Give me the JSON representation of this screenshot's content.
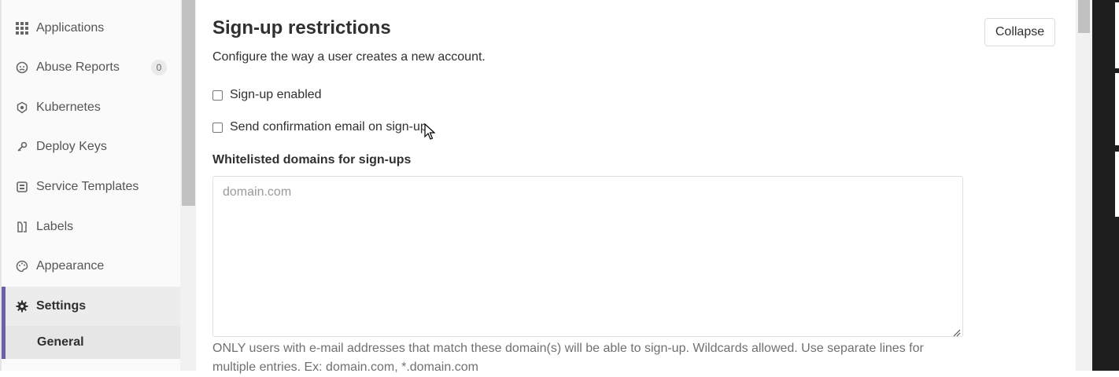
{
  "sidebar": {
    "items": [
      {
        "label": "Applications",
        "icon": "applications-icon"
      },
      {
        "label": "Abuse Reports",
        "icon": "abuse-reports-icon",
        "badge": "0"
      },
      {
        "label": "Kubernetes",
        "icon": "kubernetes-icon"
      },
      {
        "label": "Deploy Keys",
        "icon": "deploy-keys-icon"
      },
      {
        "label": "Service Templates",
        "icon": "service-templates-icon"
      },
      {
        "label": "Labels",
        "icon": "labels-icon"
      },
      {
        "label": "Appearance",
        "icon": "appearance-icon"
      },
      {
        "label": "Settings",
        "icon": "gear-icon",
        "active": true
      }
    ],
    "subitem": {
      "label": "General"
    }
  },
  "section": {
    "title": "Sign-up restrictions",
    "description": "Configure the way a user creates a new account.",
    "collapse_label": "Collapse",
    "signup_enabled": {
      "label": "Sign-up enabled",
      "checked": false
    },
    "send_confirmation": {
      "label": "Send confirmation email on sign-up",
      "checked": false
    },
    "whitelist": {
      "label": "Whitelisted domains for sign-ups",
      "placeholder": "domain.com",
      "value": "",
      "help": "ONLY users with e-mail addresses that match these domain(s) will be able to sign-up. Wildcards allowed. Use separate lines for multiple entries. Ex: domain.com, *.domain.com"
    }
  },
  "colors": {
    "accent": "#6b5fa5",
    "sidebar_bg": "#fafafa",
    "text": "#303030",
    "muted": "#707070"
  }
}
